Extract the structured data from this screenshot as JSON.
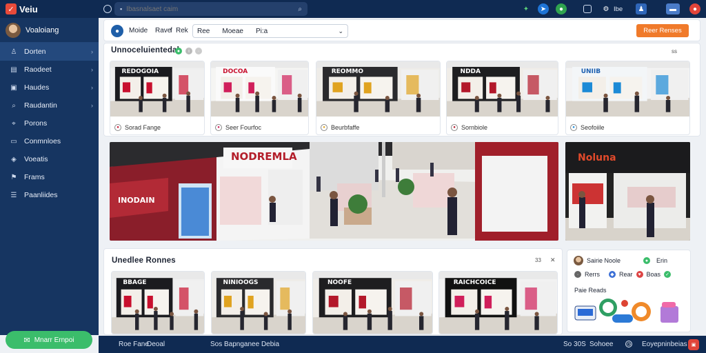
{
  "app": {
    "name": "Veiu"
  },
  "topbar": {
    "search_placeholder": "Ibasnalsaet caim",
    "icons": [
      "refresh-icon",
      "search-icon",
      "mic-icon",
      "leaf-icon",
      "rocket-icon",
      "globe-icon",
      "copy-icon",
      "settings-icon",
      "help-icon",
      "user-icon",
      "chat-icon",
      "notification-icon"
    ],
    "help_label": "Ibe"
  },
  "sidebar": {
    "profile_name": "Voaloiang",
    "items": [
      {
        "label": "Dorten",
        "icon": "user-icon",
        "active": true
      },
      {
        "label": "Raodeet",
        "icon": "doc-icon"
      },
      {
        "label": "Haudes",
        "icon": "inbox-icon"
      },
      {
        "label": "Raudantin",
        "icon": "search-icon"
      },
      {
        "label": "Porons",
        "icon": "pin-icon"
      },
      {
        "label": "Conmnloes",
        "icon": "folder-icon"
      },
      {
        "label": "Voeatis",
        "icon": "tag-icon"
      },
      {
        "label": "Frams",
        "icon": "flag-icon"
      },
      {
        "label": "Paanliides",
        "icon": "layers-icon"
      }
    ],
    "cta_label": "Mnarr Ernpoi"
  },
  "filterbar": {
    "label1": "Moide",
    "label2": "Rave",
    "label3": "f",
    "label4": "Rek",
    "select_a": "Ree",
    "select_b": "Moeae",
    "select_c": "Pi:a",
    "button": "Reer Renses"
  },
  "section1": {
    "title": "Unnoceluientedal",
    "pager": "ss",
    "cards": [
      {
        "caption": "Sorad Fange",
        "sign": "REDOGOIA"
      },
      {
        "caption": "Seer Fourfoc",
        "sign": "DOCOA"
      },
      {
        "caption": "Beurbfaffe",
        "sign": "REOMMO"
      },
      {
        "caption": "Sornbiole",
        "sign": "NDDA"
      },
      {
        "caption": "Seofoiile",
        "sign": "UNIIB"
      }
    ]
  },
  "featured": {
    "sign_main": "NODREMLA",
    "sign_side": "INODAIN",
    "side_sign": "Noluna"
  },
  "section2": {
    "title": "Unedlee Ronnes",
    "pager": "33",
    "cards": [
      {
        "sign": "BBAGE"
      },
      {
        "sign": "NINIOOGS"
      },
      {
        "sign": "NOOFE"
      },
      {
        "sign": "RAICHCOICE"
      }
    ]
  },
  "social": {
    "name": "Sairie Noole",
    "tag": "Erin",
    "row2": [
      "Rerrs",
      "Rear",
      "Boas"
    ],
    "label": "Paie Reads"
  },
  "footer": {
    "left1": "Roe Fane",
    "left2": "Deoal",
    "mid": "Sos Bapnganee Debia",
    "right1": "So 30S",
    "right2": "Sohoee",
    "right3": "Eoyepninbeias"
  },
  "colors": {
    "nav": "#0f2a52",
    "sidebar": "#163561",
    "accent": "#f07a2a",
    "green": "#3bbd6b",
    "red": "#c23a3a"
  }
}
